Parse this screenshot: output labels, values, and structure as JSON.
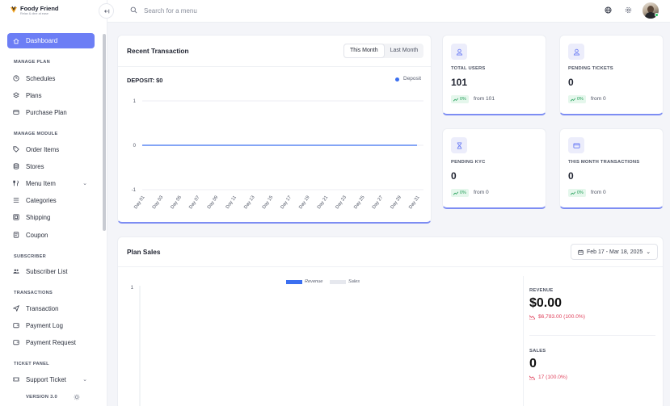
{
  "brand": {
    "name": "Foody Friend",
    "tagline": "Relax & dine at ease"
  },
  "topbar": {
    "search_placeholder": "Search for a menu"
  },
  "sidebar": {
    "active": {
      "label": "Dashboard",
      "icon": "home-icon"
    },
    "sections": [
      {
        "title": "MANAGE PLAN",
        "items": [
          {
            "label": "Schedules",
            "icon": "clock-icon"
          },
          {
            "label": "Plans",
            "icon": "layers-icon"
          },
          {
            "label": "Purchase Plan",
            "icon": "card-icon"
          }
        ]
      },
      {
        "title": "MANAGE MODULE",
        "items": [
          {
            "label": "Order Items",
            "icon": "tag-icon"
          },
          {
            "label": "Stores",
            "icon": "database-icon"
          },
          {
            "label": "Menu Item",
            "icon": "utensils-icon"
          },
          {
            "label": "Categories",
            "icon": "list-icon"
          },
          {
            "label": "Shipping",
            "icon": "ship-icon"
          },
          {
            "label": "Coupon",
            "icon": "coupon-icon"
          }
        ]
      },
      {
        "title": "SUBSCRIBER",
        "items": [
          {
            "label": "Subscriber List",
            "icon": "users-icon"
          }
        ]
      },
      {
        "title": "TRANSACTIONS",
        "items": [
          {
            "label": "Transaction",
            "icon": "send-icon"
          },
          {
            "label": "Payment Log",
            "icon": "wallet-icon"
          },
          {
            "label": "Payment Request",
            "icon": "wallet-icon"
          }
        ]
      },
      {
        "title": "TICKET PANEL",
        "items": [
          {
            "label": "Support Ticket",
            "icon": "ticket-icon"
          }
        ]
      }
    ],
    "version": "VERSION 3.0"
  },
  "recent_transaction": {
    "title": "Recent Transaction",
    "tabs": [
      "This Month",
      "Last Month"
    ],
    "active_tab": "This Month",
    "deposit_label": "DEPOSIT: $0",
    "legend": "Deposit"
  },
  "stats": [
    {
      "label": "TOTAL USERS",
      "value": "101",
      "change": "0%",
      "from": "from 101",
      "icon": "user-icon"
    },
    {
      "label": "PENDING TICKETS",
      "value": "0",
      "change": "0%",
      "from": "from 0",
      "icon": "user-icon"
    },
    {
      "label": "PENDING KYC",
      "value": "0",
      "change": "0%",
      "from": "from 0",
      "icon": "hourglass-icon"
    },
    {
      "label": "THIS MONTH TRANSACTIONS",
      "value": "0",
      "change": "0%",
      "from": "from 0",
      "icon": "card-icon"
    }
  ],
  "plan_sales": {
    "title": "Plan Sales",
    "date_range": "Feb 17 - Mar 18, 2025",
    "legend": [
      "Revenue",
      "Sales"
    ],
    "revenue_label": "REVENUE",
    "revenue_value": "$0.00",
    "revenue_change": "$6,783.00 (100.0%)",
    "sales_label": "SALES",
    "sales_value": "0",
    "sales_change": "17 (100.0%)"
  },
  "colors": {
    "accent": "#6c7ef5",
    "line": "#3b6ff0",
    "up": "#1f9d55",
    "down": "#e0445e"
  },
  "chart_data": [
    {
      "type": "line",
      "x": [
        "Day 01",
        "Day 03",
        "Day 05",
        "Day 07",
        "Day 09",
        "Day 11",
        "Day 13",
        "Day 15",
        "Day 17",
        "Day 19",
        "Day 21",
        "Day 23",
        "Day 25",
        "Day 27",
        "Day 29",
        "Day 31"
      ],
      "series": [
        {
          "name": "Deposit",
          "values": [
            0,
            0,
            0,
            0,
            0,
            0,
            0,
            0,
            0,
            0,
            0,
            0,
            0,
            0,
            0,
            0
          ]
        }
      ],
      "title": "DEPOSIT: $0",
      "yticks": [
        1,
        0,
        -1
      ],
      "ylim": [
        -1,
        1
      ],
      "grid": true,
      "legend": "top-right"
    },
    {
      "type": "bar",
      "series": [
        {
          "name": "Revenue",
          "values": []
        },
        {
          "name": "Sales",
          "values": []
        }
      ],
      "yticks": [
        1
      ],
      "legend": "top"
    }
  ]
}
